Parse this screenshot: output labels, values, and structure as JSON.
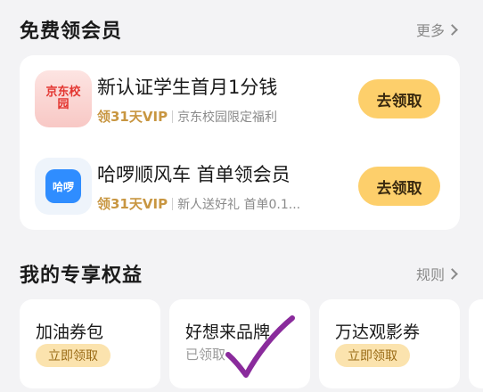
{
  "free_vip": {
    "title": "免费领会员",
    "more_label": "更多",
    "offers": [
      {
        "logo_text": "京东校园",
        "title": "新认证学生首月1分钱",
        "vip_label": "领31天VIP",
        "desc": "京东校园限定福利",
        "button_label": "去领取"
      },
      {
        "logo_text": "哈啰",
        "title": "哈啰顺风车 首单领会员",
        "vip_label": "领31天VIP",
        "desc": "新人送好礼 首单0.1...",
        "button_label": "去领取"
      }
    ]
  },
  "exclusive": {
    "title": "我的专享权益",
    "rules_label": "规则",
    "items": [
      {
        "name": "加油券包",
        "action": "立即领取"
      },
      {
        "name": "好想来品牌",
        "status": "已领取"
      },
      {
        "name": "万达观影券",
        "action": "立即领取"
      }
    ]
  },
  "colors": {
    "button": "#fdcf6b",
    "vip_text": "#c89641",
    "checkmark": "#8a2b9c"
  }
}
